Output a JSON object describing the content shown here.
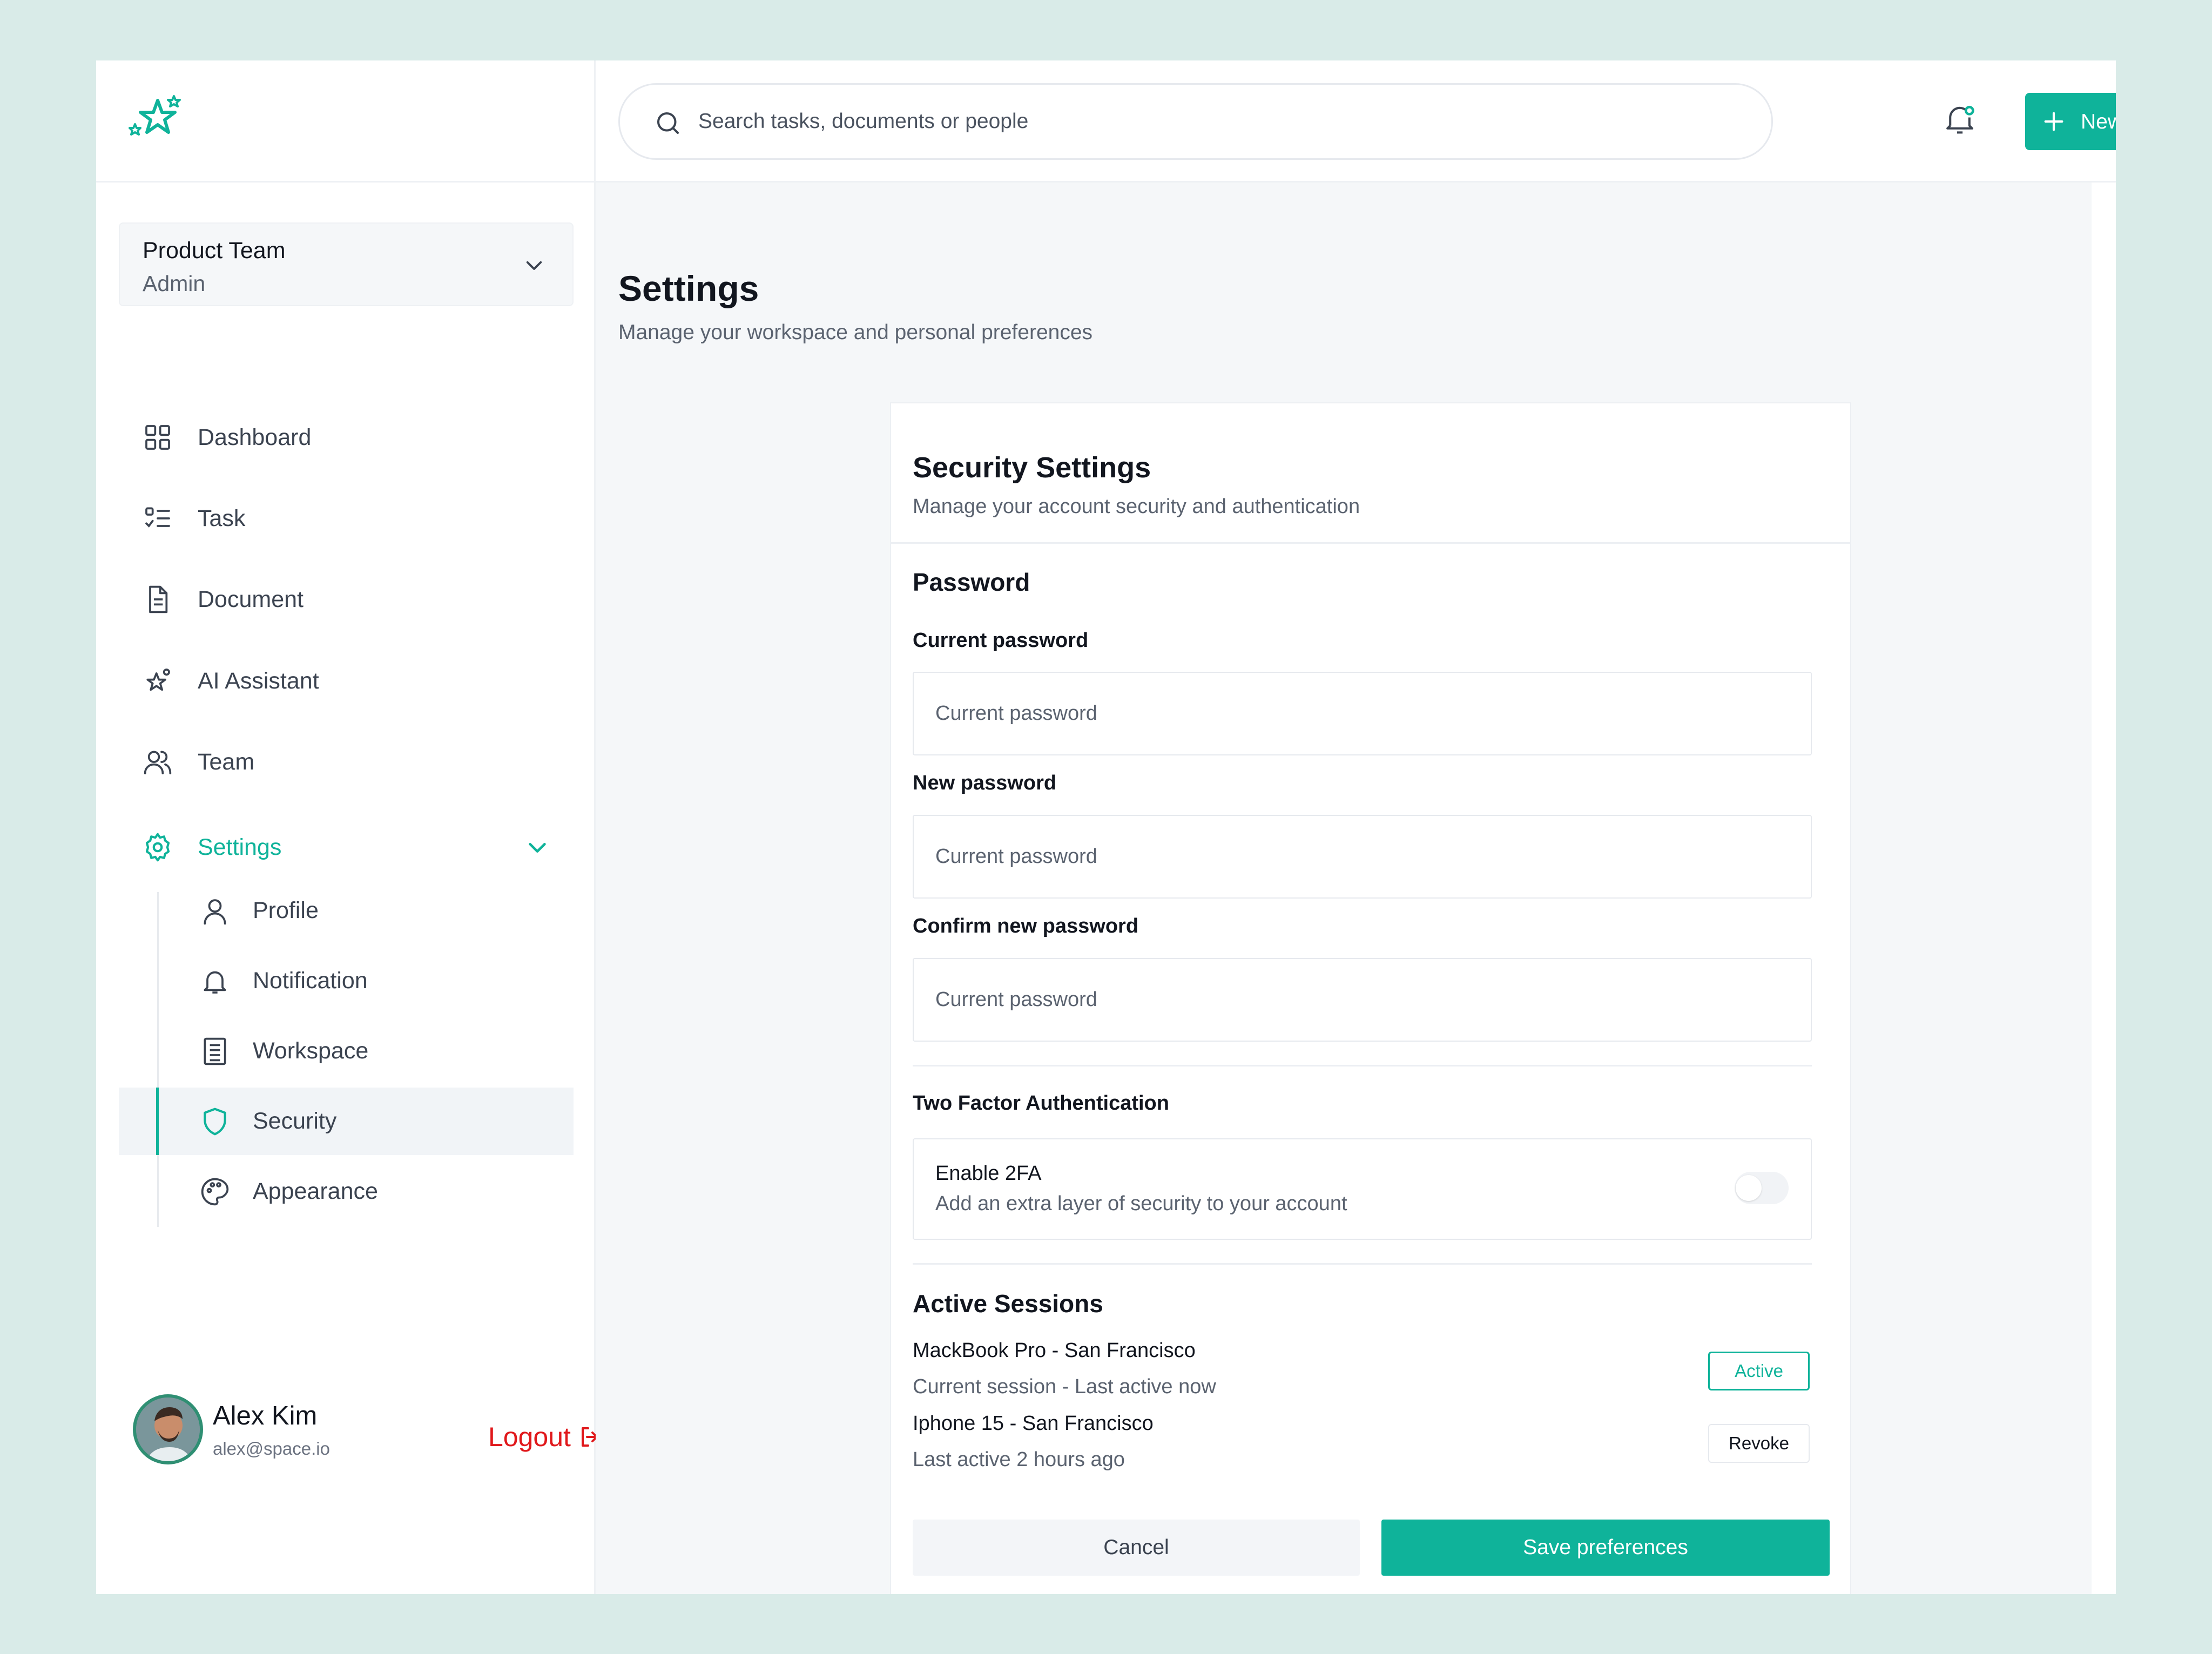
{
  "app": {
    "logo_icon": "stars-logo-icon",
    "accent_color": "#0fb39a",
    "danger_color": "#e0181b"
  },
  "search": {
    "placeholder": "Search tasks, documents or people"
  },
  "header": {
    "new_task_label": "New Task"
  },
  "workspace": {
    "name": "Product Team",
    "role": "Admin"
  },
  "sidebar": {
    "items": [
      {
        "label": "Dashboard",
        "icon": "grid-icon"
      },
      {
        "label": "Task",
        "icon": "checklist-icon"
      },
      {
        "label": "Document",
        "icon": "document-icon"
      },
      {
        "label": "AI Assistant",
        "icon": "sparkle-icon"
      },
      {
        "label": "Team",
        "icon": "users-icon"
      },
      {
        "label": "Settings",
        "icon": "gear-icon"
      }
    ],
    "settings_children": [
      {
        "label": "Profile",
        "icon": "user-icon"
      },
      {
        "label": "Notification",
        "icon": "bell-icon"
      },
      {
        "label": "Workspace",
        "icon": "workspace-icon"
      },
      {
        "label": "Security",
        "icon": "shield-icon"
      },
      {
        "label": "Appearance",
        "icon": "palette-icon"
      }
    ]
  },
  "user": {
    "name": "Alex Kim",
    "email": "alex@space.io",
    "logout_label": "Logout"
  },
  "page": {
    "title": "Settings",
    "subtitle": "Manage your workspace and personal preferences"
  },
  "security": {
    "title": "Security Settings",
    "subtitle": "Manage your account security and authentication",
    "password_section": "Password",
    "current_label": "Current password",
    "current_placeholder": "Current password",
    "new_label": "New password",
    "new_placeholder": "Current password",
    "confirm_label": "Confirm new password",
    "confirm_placeholder": "Current password",
    "twofa_section": "Two Factor Authentication",
    "twofa_title": "Enable 2FA",
    "twofa_desc": "Add an extra layer of security to your account",
    "twofa_enabled": false,
    "sessions_section": "Active Sessions",
    "sessions": [
      {
        "device": "MackBook Pro - San Francisco",
        "meta": "Current session - Last active now",
        "action": "Active"
      },
      {
        "device": "Iphone 15 - San Francisco",
        "meta": "Last active 2 hours ago",
        "action": "Revoke"
      }
    ],
    "cancel_label": "Cancel",
    "save_label": "Save preferences"
  }
}
